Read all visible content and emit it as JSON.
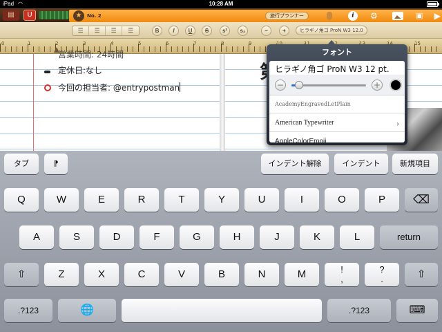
{
  "status": {
    "device": "iPad",
    "time": "10:28 AM"
  },
  "toolbar": {
    "doc_number": "No. 2",
    "doc_title": "旅行プランナー",
    "star_glyph": "★",
    "info_glyph": "i",
    "gear_glyph": "⚙",
    "camera_glyph": "▣",
    "arrow_glyph": "▶"
  },
  "format": {
    "bold": "B",
    "italic": "I",
    "underline": "U",
    "strike": "S",
    "superscript": "s²",
    "subscript": "s₂",
    "minus": "−",
    "plus": "+",
    "font_button": "ヒラギノ角ゴ ProN W3 12.0"
  },
  "ruler": {
    "labels": [
      "0",
      "1",
      "2",
      "3",
      "4",
      "5",
      "6",
      "7",
      "8",
      "9",
      "10",
      "11",
      "12",
      "13",
      "14",
      "15"
    ]
  },
  "document": {
    "line_cut": "営業時間: 24時間",
    "line1": "定休日:なし",
    "line2": "今回の担当者: @entrypostman",
    "right_char": "第"
  },
  "font_popover": {
    "title": "フォント",
    "current_font": "ヒラギノ角ゴ ProN W3 12 pt.",
    "size_minus": "−",
    "size_plus": "+",
    "size_fraction": 0.1,
    "color": "#000000",
    "fonts": [
      "AcademyEngravedLetPlain",
      "American Typewriter",
      "AppleColorEmoji"
    ]
  },
  "keyboard": {
    "toolbar_keys": {
      "tab": "タブ",
      "mark": "⁋",
      "outdent": "インデント解除",
      "indent": "インデント",
      "new_item": "新規項目"
    },
    "row1": [
      "Q",
      "W",
      "E",
      "R",
      "T",
      "Y",
      "U",
      "I",
      "O",
      "P"
    ],
    "backspace": "⌫",
    "row2": [
      "A",
      "S",
      "D",
      "F",
      "G",
      "H",
      "J",
      "K",
      "L"
    ],
    "return": "return",
    "shift": "⇧",
    "row3": [
      "Z",
      "X",
      "C",
      "V",
      "B",
      "N",
      "M"
    ],
    "exclam": [
      "!",
      ","
    ],
    "question": [
      "?",
      "."
    ],
    "numbers": ".?123",
    "globe": "🌐",
    "hide": "⌨"
  }
}
